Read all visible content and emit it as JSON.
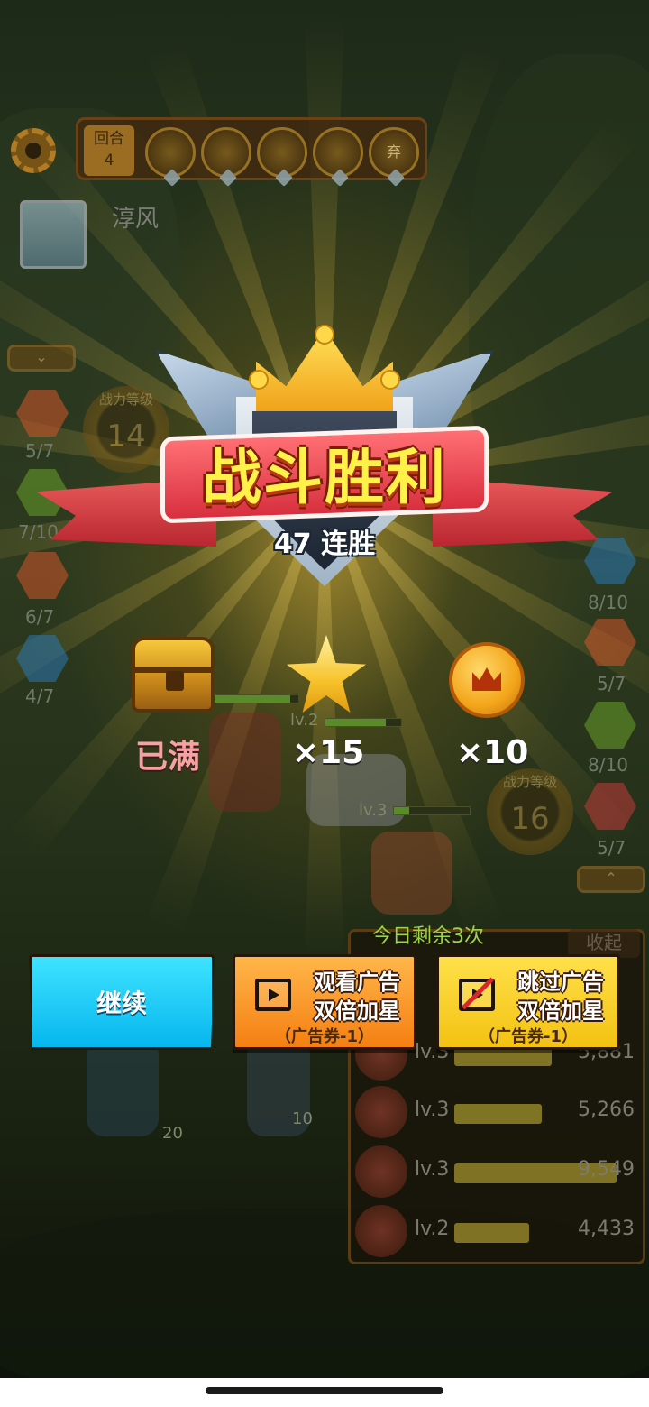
{
  "hud": {
    "round_label": "回合",
    "round_number": "4",
    "skills": [
      {
        "icon": "lightning-skill-icon",
        "label": ""
      },
      {
        "icon": "robot-skill-icon",
        "label": ""
      },
      {
        "icon": "shield-skill-icon",
        "label": ""
      },
      {
        "icon": "burst-skill-icon",
        "label": ""
      },
      {
        "icon": "abandon-skill-icon",
        "label": "弃"
      }
    ],
    "player_name": "淳风"
  },
  "left_slots": [
    {
      "count": "5/7",
      "color": "#d2552a"
    },
    {
      "count": "7/10",
      "color": "#6aa02a"
    },
    {
      "count": "6/7",
      "color": "#d2552a"
    },
    {
      "count": "4/7",
      "color": "#2a78b4"
    }
  ],
  "right_slots": [
    {
      "count": "8/10",
      "color": "#2a78b4"
    },
    {
      "count": "5/7",
      "color": "#d2552a"
    },
    {
      "count": "8/10",
      "color": "#6aa02a"
    },
    {
      "count": "5/7",
      "color": "#c23a3a"
    }
  ],
  "power_left": {
    "label": "战力等级",
    "value": "14"
  },
  "power_right": {
    "label": "战力等级",
    "value": "16"
  },
  "units": [
    {
      "level": "lv.2"
    },
    {
      "level": "lv.3"
    }
  ],
  "victory": {
    "title": "战斗胜利",
    "streak": "47 连胜"
  },
  "rewards": [
    {
      "icon": "treasure-chest-icon",
      "label": "已满"
    },
    {
      "icon": "star-icon",
      "label": "×15"
    },
    {
      "icon": "crown-coin-icon",
      "label": "×10"
    }
  ],
  "remaining_today": "今日剩余3次",
  "buttons": {
    "continue": "继续",
    "watch_ad": {
      "line1": "观看广告",
      "line2": "双倍加星",
      "sub": "（广告券-1）"
    },
    "skip_ad": {
      "line1": "跳过广告",
      "line2": "双倍加星",
      "sub": "（广告券-1）"
    }
  },
  "side_list": {
    "collapse_label": "收起",
    "rows": [
      {
        "level": "lv.3",
        "damage": "5,881",
        "fill": 0.3
      },
      {
        "level": "lv.3",
        "damage": "5,266",
        "fill": 0.27
      },
      {
        "level": "lv.3",
        "damage": "9,549",
        "fill": 0.5
      },
      {
        "level": "lv.2",
        "damage": "4,433",
        "fill": 0.23
      }
    ]
  },
  "ground_markers": [
    "20",
    "10"
  ]
}
